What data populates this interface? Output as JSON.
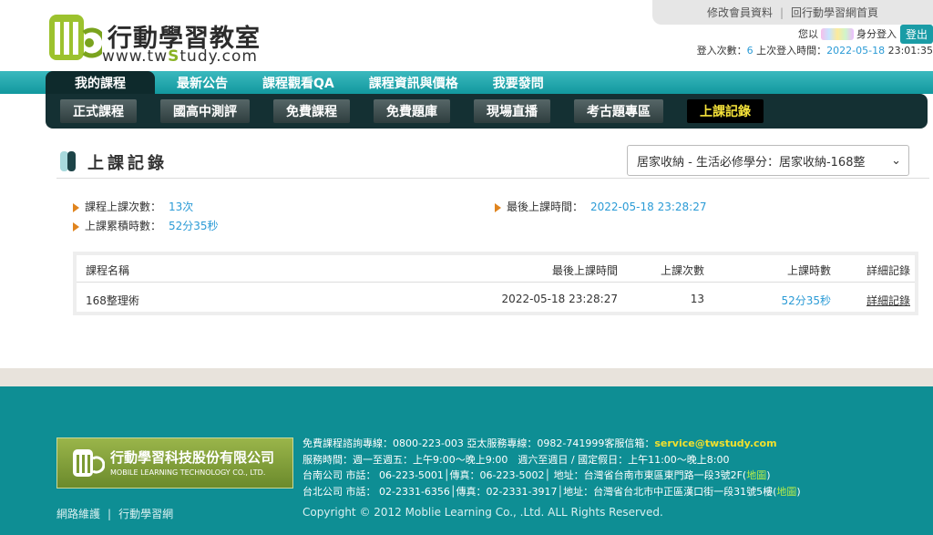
{
  "header": {
    "logo_cn": "行動學習教室",
    "logo_url_pre": "www.tw",
    "logo_url_hl": "S",
    "logo_url_post": "tudy.com",
    "top_links": [
      "修改會員資料",
      "回行動學習網首頁"
    ],
    "user_prefix": "您以",
    "user_suffix": "身分登入",
    "logout_label": "登出",
    "login_count_label": "登入次數：",
    "login_count": "6",
    "last_login_label": " 上次登入時間：",
    "last_login_date": "2022-05-18",
    "last_login_time": " 23:01:35"
  },
  "nav": {
    "top": [
      "我的課程",
      "最新公告",
      "課程觀看QA",
      "課程資訊與價格",
      "我要發問"
    ],
    "sub": [
      "正式課程",
      "國高中測評",
      "免費課程",
      "免費題庫",
      "現場直播",
      "考古題專區",
      "上課記錄"
    ]
  },
  "page": {
    "title": "上課記錄",
    "course_select_value": "居家收納 - 生活必修學分：居家收納-168整"
  },
  "stats": {
    "count_label": "課程上課次數：",
    "count_value": "13次",
    "time_label": "上課累積時數：",
    "time_value": "52分35秒",
    "last_label": "最後上課時間：",
    "last_value": "2022-05-18 23:28:27"
  },
  "table": {
    "headers": [
      "課程名稱",
      "最後上課時間",
      "上課次數",
      "上課時數",
      "詳細記錄"
    ],
    "rows": [
      {
        "name": "168整理術",
        "last": "2022-05-18 23:28:27",
        "count": "13",
        "time": "52分35秒",
        "detail": "詳細記錄"
      }
    ]
  },
  "footer": {
    "company_cn": "行動學習科技股份有限公司",
    "company_en": "MOBILE LEARNING TECHNOLOGY CO., LTD.",
    "line1_pre": "免費課程諮詢專線：0800-223-003 亞太服務專線：0982-741999客服信箱：",
    "email": "service@twstudy.com",
    "line2": "服務時間：週一至週五：上午9:00～晚上9:00　週六至週日 / 國定假日：上午11:00～晚上8:00",
    "line3_pre": "台南公司 市話： 06-223-5001│傳真：06-223-5002│ 地址：台灣省台南市東區東門路一段3號2F(",
    "map": "地圖",
    "line3_post": ")",
    "line4_pre": "台北公司 市話： 02-2331-6356│傳真：02-2331-3917│地址：台灣省台北市中正區漢口街一段31號5樓(",
    "line4_post": ")",
    "links": [
      "網路維護",
      "行動學習網"
    ],
    "copyright": "Copyright © 2012 Moblie Learning Co., .Ltd. ALL Rights Reserved."
  },
  "colors": {
    "teal": "#1aa4aa",
    "dark_nav": "#143033",
    "accent_blue": "#2b9bd6",
    "arrow_orange": "#e0841e",
    "logo_green": "#8ab325",
    "active_yellow": "#f6e33a"
  }
}
